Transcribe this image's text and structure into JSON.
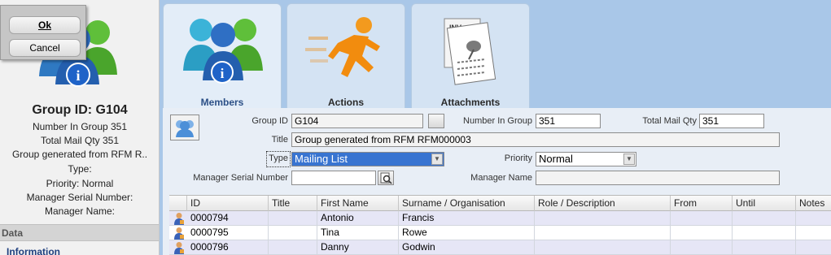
{
  "dialog": {
    "ok_label": "Ok",
    "cancel_label": "Cancel"
  },
  "left_panel": {
    "group_title": "Group ID: G104",
    "lines": [
      "Number In Group 351",
      "Total Mail Qty 351",
      "Group generated from RFM R..",
      "Type:",
      "Priority: Normal",
      "Manager Serial Number:",
      "Manager Name:"
    ],
    "data_header": "Data",
    "info_link": "Information"
  },
  "tabs": [
    {
      "label": "Members",
      "icon": "members-icon",
      "active": true
    },
    {
      "label": "Actions",
      "icon": "running-man-icon",
      "active": false
    },
    {
      "label": "Attachments",
      "icon": "documents-pin-icon",
      "active": false
    }
  ],
  "form": {
    "group_id_label": "Group ID",
    "group_id_value": "G104",
    "number_in_group_label": "Number In Group",
    "number_in_group_value": "351",
    "total_mail_qty_label": "Total Mail Qty",
    "total_mail_qty_value": "351",
    "title_label": "Title",
    "title_value": "Group generated from RFM RFM000003",
    "type_label": "Type",
    "type_value": "Mailing List",
    "priority_label": "Priority",
    "priority_value": "Normal",
    "manager_serial_label": "Manager Serial Number",
    "manager_serial_value": "",
    "manager_name_label": "Manager Name",
    "manager_name_value": ""
  },
  "grid": {
    "columns": [
      "ID",
      "Title",
      "First Name",
      "Surname / Organisation",
      "Role / Description",
      "From",
      "Until",
      "Notes"
    ],
    "rows": [
      {
        "id": "0000794",
        "title": "",
        "first_name": "Antonio",
        "surname": "Francis",
        "role": "",
        "from": "",
        "until": "",
        "notes": ""
      },
      {
        "id": "0000795",
        "title": "",
        "first_name": "Tina",
        "surname": "Rowe",
        "role": "",
        "from": "",
        "until": "",
        "notes": ""
      },
      {
        "id": "0000796",
        "title": "",
        "first_name": "Danny",
        "surname": "Godwin",
        "role": "",
        "from": "",
        "until": "",
        "notes": ""
      }
    ]
  },
  "colors": {
    "background": "#a9c7e8",
    "active_tab_label": "#2b4f86",
    "selected_combo": "#3874d1",
    "alt_row": "#e6e6f6"
  }
}
